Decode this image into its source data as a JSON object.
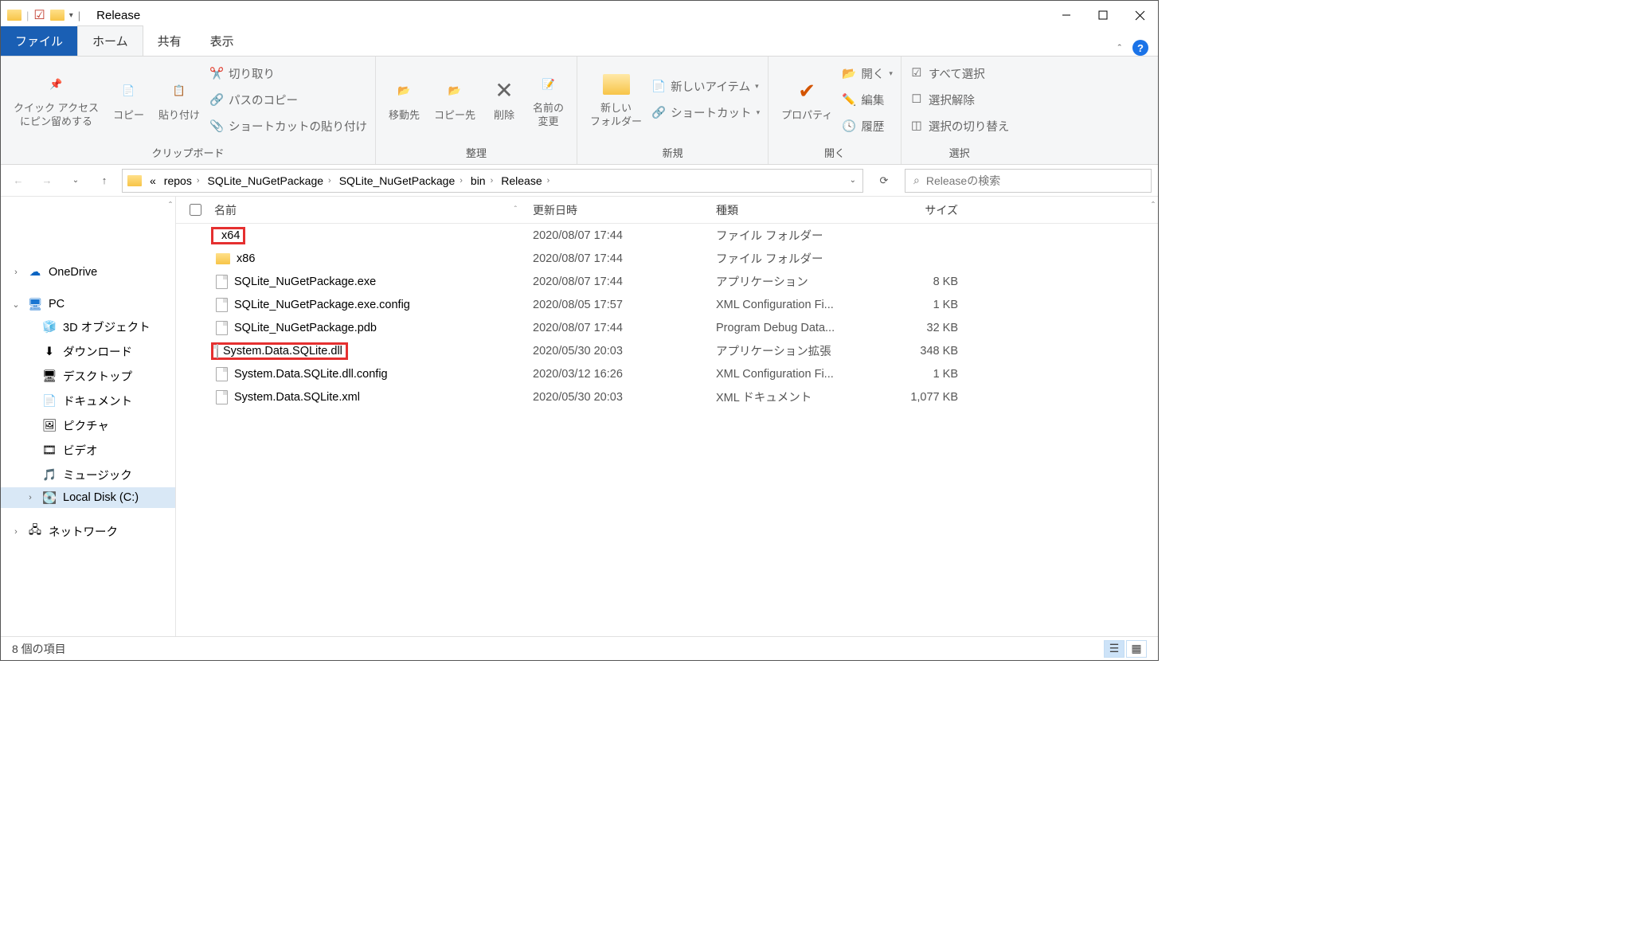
{
  "window_title": "Release",
  "tabs": {
    "file": "ファイル",
    "home": "ホーム",
    "share": "共有",
    "view": "表示"
  },
  "ribbon": {
    "clipboard": {
      "pin": "クイック アクセス\nにピン留めする",
      "copy": "コピー",
      "paste": "貼り付け",
      "cut": "切り取り",
      "copypath": "パスのコピー",
      "pasteshortcut": "ショートカットの貼り付け",
      "label": "クリップボード"
    },
    "organize": {
      "moveto": "移動先",
      "copyto": "コピー先",
      "delete": "削除",
      "rename": "名前の\n変更",
      "label": "整理"
    },
    "new": {
      "newfolder": "新しい\nフォルダー",
      "newitem": "新しいアイテム",
      "shortcut": "ショートカット",
      "label": "新規"
    },
    "open": {
      "properties": "プロパティ",
      "open": "開く",
      "edit": "編集",
      "history": "履歴",
      "label": "開く"
    },
    "select": {
      "all": "すべて選択",
      "none": "選択解除",
      "invert": "選択の切り替え",
      "label": "選択"
    }
  },
  "breadcrumbs": [
    "repos",
    "SQLite_NuGetPackage",
    "SQLite_NuGetPackage",
    "bin",
    "Release"
  ],
  "search_placeholder": "Releaseの検索",
  "tree": {
    "onedrive": "OneDrive",
    "pc": "PC",
    "items": [
      "3D オブジェクト",
      "ダウンロード",
      "デスクトップ",
      "ドキュメント",
      "ピクチャ",
      "ビデオ",
      "ミュージック",
      "Local Disk (C:)"
    ],
    "network": "ネットワーク"
  },
  "columns": {
    "name": "名前",
    "date": "更新日時",
    "type": "種類",
    "size": "サイズ"
  },
  "files": [
    {
      "icon": "folder",
      "name": "x64",
      "date": "2020/08/07 17:44",
      "type": "ファイル フォルダー",
      "size": "",
      "highlight": true
    },
    {
      "icon": "folder",
      "name": "x86",
      "date": "2020/08/07 17:44",
      "type": "ファイル フォルダー",
      "size": ""
    },
    {
      "icon": "exe",
      "name": "SQLite_NuGetPackage.exe",
      "date": "2020/08/07 17:44",
      "type": "アプリケーション",
      "size": "8 KB"
    },
    {
      "icon": "config",
      "name": "SQLite_NuGetPackage.exe.config",
      "date": "2020/08/05 17:57",
      "type": "XML Configuration Fi...",
      "size": "1 KB"
    },
    {
      "icon": "pdb",
      "name": "SQLite_NuGetPackage.pdb",
      "date": "2020/08/07 17:44",
      "type": "Program Debug Data...",
      "size": "32 KB"
    },
    {
      "icon": "dll",
      "name": "System.Data.SQLite.dll",
      "date": "2020/05/30 20:03",
      "type": "アプリケーション拡張",
      "size": "348 KB",
      "highlight": true
    },
    {
      "icon": "config",
      "name": "System.Data.SQLite.dll.config",
      "date": "2020/03/12 16:26",
      "type": "XML Configuration Fi...",
      "size": "1 KB"
    },
    {
      "icon": "xml",
      "name": "System.Data.SQLite.xml",
      "date": "2020/05/30 20:03",
      "type": "XML ドキュメント",
      "size": "1,077 KB"
    }
  ],
  "status": "8 個の項目"
}
